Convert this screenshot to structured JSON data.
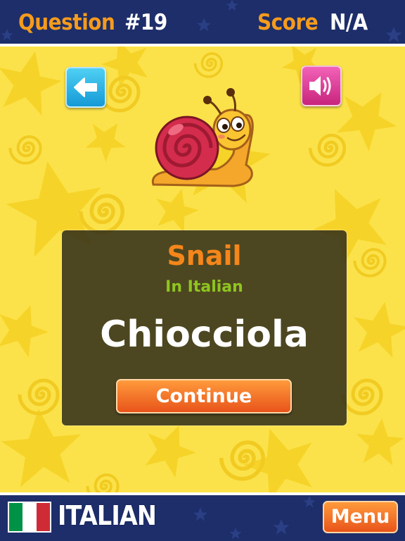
{
  "header": {
    "question_label": "Question",
    "question_number": "#19",
    "score_label": "Score",
    "score_value": "N/A"
  },
  "buttons": {
    "back_icon": "left-arrow-icon",
    "sound_icon": "speaker-icon",
    "continue_label": "Continue",
    "menu_label": "Menu"
  },
  "card": {
    "word": "Snail",
    "in_language": "In Italian",
    "translation": "Chiocciola"
  },
  "picture": {
    "subject": "snail-illustration"
  },
  "footer": {
    "language_name": "ITALIAN",
    "flag_colors": [
      "#009246",
      "#ffffff",
      "#ce2b37"
    ]
  },
  "colors": {
    "background": "#fbe24a",
    "bar": "#1d2e6a",
    "accent_orange": "#f5861a",
    "accent_green": "#8fc51f"
  }
}
